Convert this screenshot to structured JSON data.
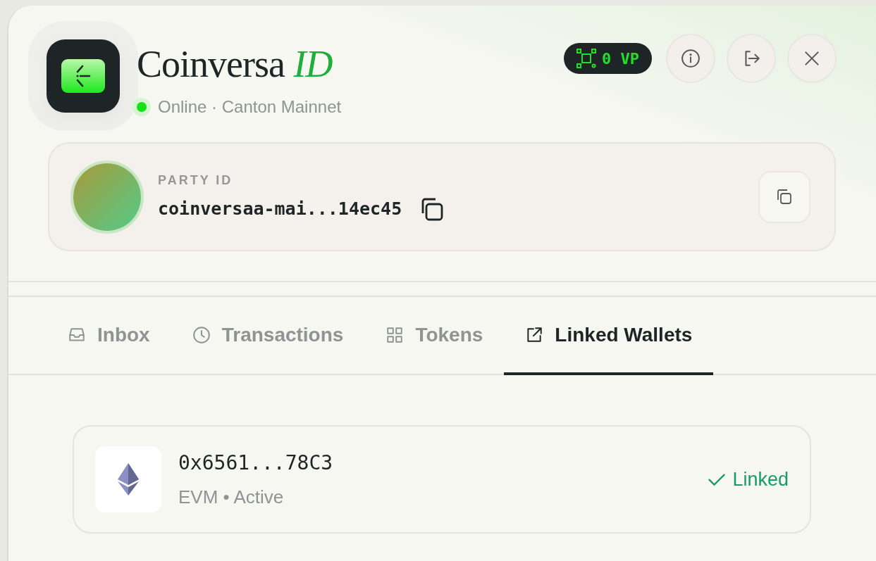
{
  "app": {
    "title": "Coinversa",
    "title_suffix": "ID",
    "status": {
      "online": true,
      "text": "Online · Canton Mainnet"
    }
  },
  "points_badge": {
    "text": "0 VP"
  },
  "header_buttons": [
    {
      "kind": "info"
    },
    {
      "kind": "logout"
    },
    {
      "kind": "close"
    }
  ],
  "party": {
    "label": "PARTY ID",
    "id": "coinversaa-mai...14ec45"
  },
  "tabs": [
    {
      "kind": "inbox",
      "label": "Inbox",
      "selected": false
    },
    {
      "kind": "clock",
      "label": "Transactions",
      "selected": false
    },
    {
      "kind": "grid",
      "label": "Tokens",
      "selected": false
    },
    {
      "kind": "external",
      "label": "Linked Wallets",
      "selected": true
    }
  ],
  "wallets": [
    {
      "address": "0x6561...78C3",
      "subtitle": "EVM • Active",
      "status": "Linked",
      "linked": true
    }
  ]
}
